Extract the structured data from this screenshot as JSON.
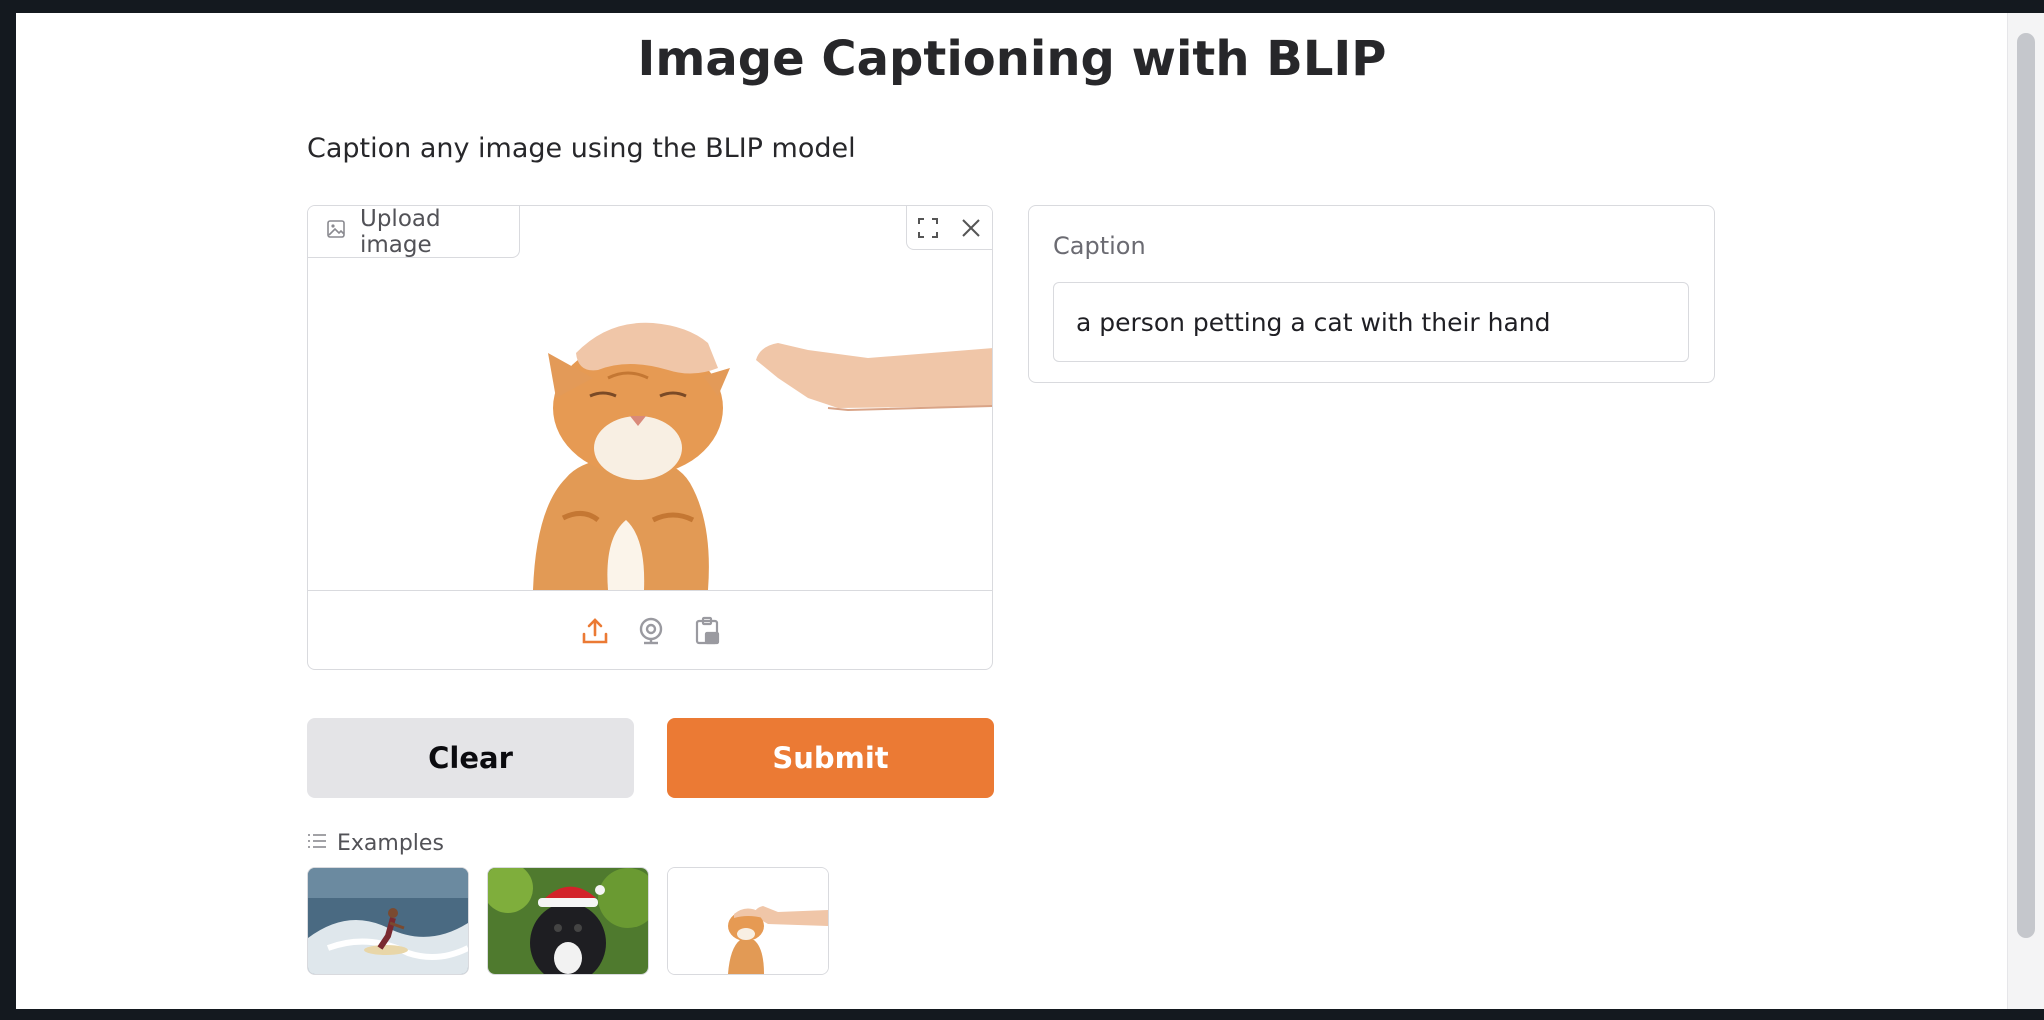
{
  "page": {
    "title": "Image Captioning with BLIP",
    "description": "Caption any image using the BLIP model"
  },
  "image_input": {
    "label": "Upload image",
    "image_content": "orange tabby cat being petted on the head by a hand",
    "tools": [
      "fullscreen-icon",
      "close-icon"
    ],
    "sources": [
      "upload-icon",
      "webcam-icon",
      "clipboard-icon"
    ],
    "active_source": "upload"
  },
  "buttons": {
    "clear": "Clear",
    "submit": "Submit"
  },
  "examples": {
    "label": "Examples",
    "items": [
      {
        "content": "surfer riding a wave"
      },
      {
        "content": "black dog wearing a santa hat"
      },
      {
        "content": "cat being petted by a hand"
      }
    ]
  },
  "output": {
    "label": "Caption",
    "value": "a person petting a cat with their hand"
  },
  "colors": {
    "accent": "#eb7a34",
    "secondary_button": "#e4e4e7",
    "border": "#d9dade"
  }
}
